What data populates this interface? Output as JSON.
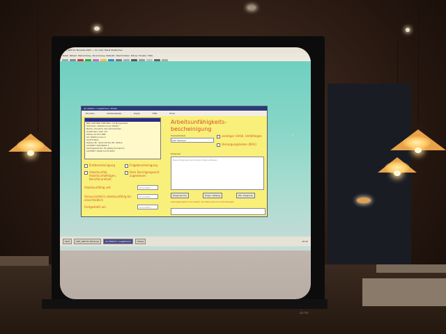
{
  "app": {
    "title": "KSE_ARE für Windows 2007 — Dr. med. Maria Musterfrau",
    "menu": [
      "Datei",
      "Patient",
      "Behandlung",
      "Abrechnung",
      "Statistik",
      "Stammdaten",
      "Extras",
      "Fenster",
      "Hilfe"
    ]
  },
  "dialog": {
    "title": "AU 000017 / Angstmann, Tobias",
    "tabs": [
      "Drucken",
      "Krankenkasse",
      "Kopie",
      "Hilfe",
      "Ende"
    ],
    "card": {
      "lines": [
        "BKK VOR BKK DRE BKK, Ort Bingenhofe",
        "Schulden, Steinbrunnen  60429",
        "Name, Vorname des Versicherten",
        "Angstmann             geb. am",
        "Tobias                10.05.1968",
        "Am Wallbrunnen 2",
        "31075 Wein",
        "Kassen-Nr.   Versicherten-Nr.   Status",
        "1234567      45678901   1",
        "Vertragsarzt-Nr.  VK gültig bis  Datum",
        "1234567    10/06    10.10.2007"
      ]
    },
    "form_title": "Arbeitsunfähigkeits-bescheinigung",
    "praxisstempel_label": "Praxisstempel",
    "praxisstempel_value": "kein Stempel",
    "checks_right": [
      "sonstiger Unfall, Unfallfolgen",
      "Versorgungsleiden (BVG)"
    ],
    "checks_left": [
      "Erstbescheinigung",
      "Folgebescheinigung",
      "Arbeitsunfall, Arbeitsunfallfolgen, Berufskrankheit",
      "Dem Durchgangsarzt zugewiesen"
    ],
    "diagnosis_label": "Diagnose",
    "diagnosis_placeholder": "Neue Diagnose auf anderer Seite erfassen",
    "date_rows": [
      {
        "label": "Arbeitsunfähig seit",
        "value": "10.10.2007"
      },
      {
        "label": "Voraussichtlich arbeitsunfähig bis einschließlich",
        "value": "12.10.2007"
      },
      {
        "label": "Festgestellt am",
        "value": "10.10.2007"
      }
    ],
    "buttons": [
      "Diagnose frei",
      "Diagn. Katalog",
      "Pat. Diagnose"
    ],
    "footnote": "Leistungsausgleich nach Gesetz, der letzte Anspruch auf Krankengeld"
  },
  "taskbar": {
    "start": "Start",
    "items": [
      "KSE_ARE für Windows",
      "AU 000017 / Angstmann",
      "Tobias"
    ],
    "tray": "10:42"
  },
  "brand": "da-lite"
}
